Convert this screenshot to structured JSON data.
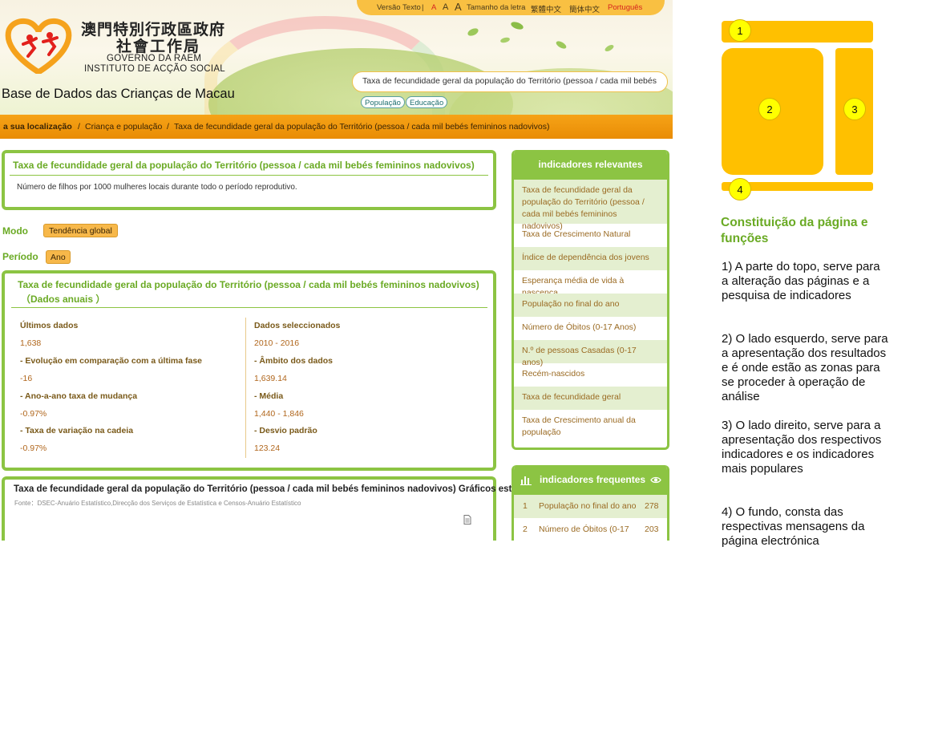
{
  "toolbar": {
    "versao_texto": "Versão Texto",
    "separator": "|",
    "font_small": "A",
    "font_medium": "A",
    "font_large": "A",
    "font_size_label": "Tamanho da letra",
    "lang_traditional": "繁體中文",
    "lang_simplified": "簡体中文",
    "lang_portuguese": "Português"
  },
  "header": {
    "logo_zh_line1": "澳門特別行政區政府",
    "logo_zh_line2": "社會工作局",
    "logo_pt_line1": "GOVERNO DA RAEM",
    "logo_pt_line2": "INSTITUTO DE ACÇÃO SOCIAL",
    "site_title": "Base de Dados das Crianças de Macau",
    "search_value": "Taxa de fecundidade geral da população do Território (pessoa / cada mil bebés",
    "tags": [
      "População",
      "Educação"
    ]
  },
  "breadcrumb": {
    "prefix": "a sua localização",
    "sep": "/",
    "items": [
      "Criança e população",
      "Taxa de fecundidade geral da população do Território (pessoa / cada mil bebés femininos nadovivos)"
    ]
  },
  "description": {
    "title": "Taxa de fecundidade geral da população do Território (pessoa / cada mil bebés femininos nadovivos)",
    "text": "Número de filhos por 1000 mulheres locais durante todo o período reprodutivo."
  },
  "controls": {
    "modo_label": "Modo",
    "modo_value": "Tendência global",
    "periodo_label": "Período",
    "periodo_value": "Ano"
  },
  "stats": {
    "title": "Taxa de fecundidade geral da população do Território (pessoa / cada mil bebés femininos nadovivos)",
    "subtitle": "（Dados anuais ）",
    "left": [
      {
        "label": "Últimos dados",
        "value": "1,638"
      },
      {
        "label": "- Evolução em comparação com a última fase",
        "value": "-16"
      },
      {
        "label": "- Ano-a-ano taxa de mudança",
        "value": "-0.97%"
      },
      {
        "label": "- Taxa de variação na cadeia",
        "value": "-0.97%"
      }
    ],
    "right": [
      {
        "label": "Dados seleccionados",
        "value": "2010 - 2016"
      },
      {
        "label": "- Âmbito dos dados",
        "value": "1,639.14"
      },
      {
        "label": "- Média",
        "value": "1,440 - 1,846"
      },
      {
        "label": "- Desvio padrão",
        "value": "123.24"
      }
    ]
  },
  "chart_section": {
    "title": "Taxa de fecundidade geral da população do Território (pessoa / cada mil bebés femininos nadovivos)  Gráficos esta",
    "source": "Fonte：DSEC-Anuário Estatístico,Direcção dos Serviços de Estatística e Censos-Anuário Estatístico"
  },
  "relevant": {
    "header": "indicadores relevantes",
    "items": [
      "Taxa de fecundidade geral da população do Território (pessoa / cada mil bebés femininos nadovivos)",
      "Taxa de Crescimento Natural",
      "Índice de dependência dos jovens",
      "Esperança média de vida à nascença",
      "População no final do ano",
      "Número de Óbitos (0-17 Anos)",
      "N.º de pessoas Casadas (0-17 anos)",
      "Recém-nascidos",
      "Taxa de fecundidade geral",
      "Taxa de Crescimento anual da população"
    ]
  },
  "frequent": {
    "header": "indicadores frequentes",
    "rows": [
      {
        "rank": "1",
        "name": "População no final do ano",
        "count": "278"
      },
      {
        "rank": "2",
        "name": "Número de Óbitos (0-17",
        "count": "203"
      }
    ]
  },
  "guide": {
    "numbers": [
      "1",
      "2",
      "3",
      "4"
    ],
    "heading": "Constituição da página e funções",
    "items": [
      "1) A parte do topo, serve para a alteração das páginas e a pesquisa de  indicadores",
      "2) O lado esquerdo, serve para a apresentação dos resultados e é onde estão as zonas para se proceder à operação de análise",
      "3) O lado direito, serve para a apresentação dos respectivos indicadores e os indicadores mais populares",
      "4) O fundo, consta das respectivas mensagens da página electrónica"
    ]
  },
  "colors": {
    "accent_green": "#8cc443",
    "accent_orange": "#f6a317",
    "guide_yellow": "#ffc000"
  }
}
